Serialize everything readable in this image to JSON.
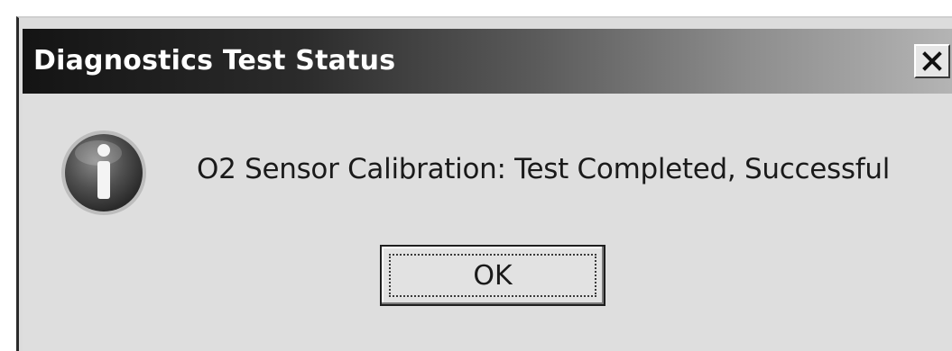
{
  "dialog": {
    "title": "Diagnostics Test Status",
    "close_label": "close",
    "message": "O2 Sensor Calibration: Test Completed, Successful",
    "ok_label": "OK",
    "icon": "info-icon",
    "close_icon": "close-icon"
  }
}
